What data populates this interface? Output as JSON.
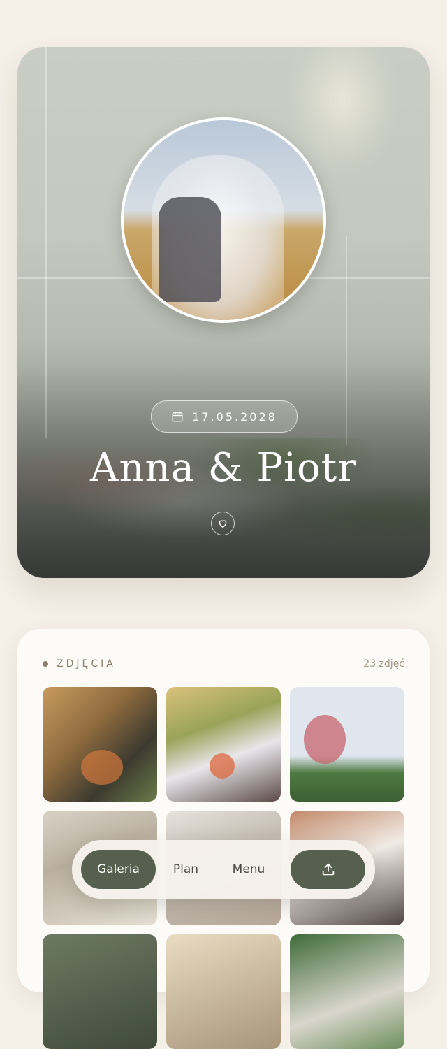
{
  "hero": {
    "date": "17.05.2028",
    "names": "Anna & Piotr"
  },
  "gallery": {
    "title": "ZDJĘCIA",
    "count": "23 zdjęć"
  },
  "nav": {
    "items": [
      {
        "label": "Galeria",
        "active": true
      },
      {
        "label": "Plan",
        "active": false
      },
      {
        "label": "Menu",
        "active": false
      }
    ],
    "upload_icon": "upload-icon"
  },
  "colors": {
    "accent": "#56604f",
    "background": "#f4efe7",
    "card": "#fdfbf8",
    "muted_text": "#8a7e6e"
  }
}
